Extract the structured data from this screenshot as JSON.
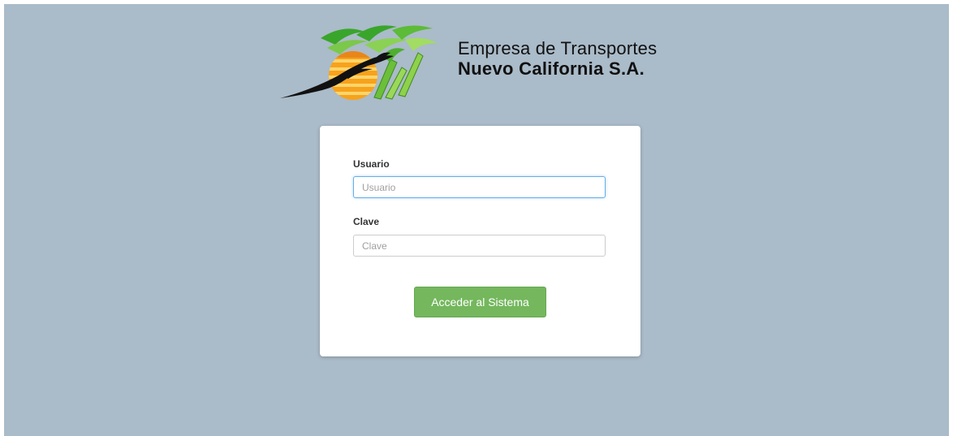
{
  "brand": {
    "line1": "Empresa de Transportes",
    "line2": "Nuevo California S.A."
  },
  "login": {
    "user_label": "Usuario",
    "user_placeholder": "Usuario",
    "user_value": "",
    "password_label": "Clave",
    "password_placeholder": "Clave",
    "password_value": "",
    "submit_label": "Acceder al Sistema"
  },
  "colors": {
    "background": "#aabbc9",
    "card": "#ffffff",
    "button": "#74b75d",
    "focus_border": "#66afe9"
  },
  "icons": {
    "logo": "palm-trees-sun-bird-logo"
  }
}
